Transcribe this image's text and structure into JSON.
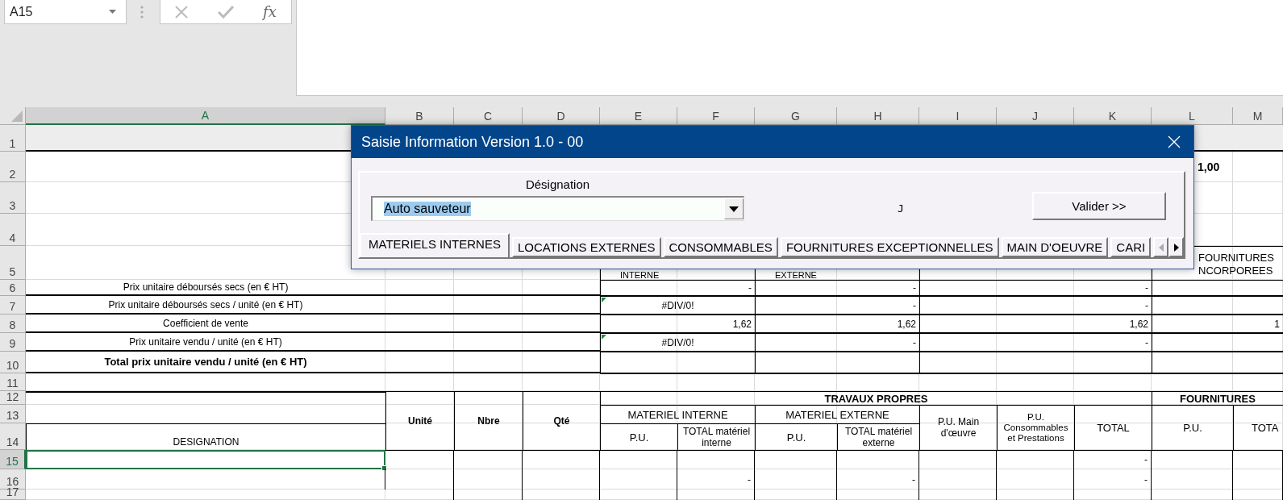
{
  "name_box": {
    "value": "A15"
  },
  "formula_bar": {
    "function_label": "fx"
  },
  "column_headers": [
    {
      "label": "A",
      "selected": true
    },
    {
      "label": "B",
      "selected": false
    },
    {
      "label": "C",
      "selected": false
    },
    {
      "label": "D",
      "selected": false
    },
    {
      "label": "E",
      "selected": false
    },
    {
      "label": "F",
      "selected": false
    },
    {
      "label": "G",
      "selected": false
    },
    {
      "label": "H",
      "selected": false
    },
    {
      "label": "I",
      "selected": false
    },
    {
      "label": "J",
      "selected": false
    },
    {
      "label": "K",
      "selected": false
    },
    {
      "label": "L",
      "selected": false
    },
    {
      "label": "M",
      "selected": false
    }
  ],
  "row_headers": [
    {
      "label": "1",
      "selected": false
    },
    {
      "label": "2",
      "selected": false
    },
    {
      "label": "3",
      "selected": false
    },
    {
      "label": "4",
      "selected": false
    },
    {
      "label": "5",
      "selected": false
    },
    {
      "label": "6",
      "selected": false
    },
    {
      "label": "7",
      "selected": false
    },
    {
      "label": "8",
      "selected": false
    },
    {
      "label": "9",
      "selected": false
    },
    {
      "label": "10",
      "selected": false
    },
    {
      "label": "11",
      "selected": false
    },
    {
      "label": "12",
      "selected": false
    },
    {
      "label": "13",
      "selected": false
    },
    {
      "label": "14",
      "selected": false
    },
    {
      "label": "15",
      "selected": true
    },
    {
      "label": "16",
      "selected": false
    },
    {
      "label": "17",
      "selected": false
    }
  ],
  "sheet": {
    "total_value": "1,00",
    "internal_heading": "INTERNE",
    "external_heading": "EXTERNE",
    "supplies_heading": [
      "FOURNITURES",
      "NCORPOREES"
    ]
  },
  "summary_rows": [
    {
      "label": "Prix unitaire déboursés secs (en € HT)",
      "bold": false,
      "internal": {
        "text": "-",
        "flag": false
      },
      "external": "-",
      "labour": "-"
    },
    {
      "label": "Prix unitaire déboursés secs / unité (en € HT)",
      "bold": false,
      "internal": {
        "text": "#DIV/0!",
        "flag": true
      },
      "external": "-",
      "labour": "-"
    },
    {
      "label": "Coefficient de vente",
      "bold": false,
      "internal": {
        "text": "1,62",
        "flag": false
      },
      "external": "1,62",
      "labour": "1,62",
      "supplies": "1"
    },
    {
      "label": "Prix unitaire vendu / unité (en € HT)",
      "bold": false,
      "internal": {
        "text": "#DIV/0!",
        "flag": true
      },
      "external": "-",
      "labour": "-"
    },
    {
      "label": "Total prix unitaire vendu / unité (en € HT)",
      "bold": true
    }
  ],
  "table_header": {
    "designation": "DESIGNATION",
    "unit": "Unité",
    "count": "Nbre",
    "quantity": "Qté",
    "own_works": "TRAVAUX PROPRES",
    "supplies": "FOURNITURES",
    "internal": "MATERIEL INTERNE",
    "external": "MATERIEL EXTERNE",
    "internal_pu": "P.U.",
    "internal_total": "TOTAL matériel interne",
    "external_pu": "P.U.",
    "external_total": "TOTAL matériel externe",
    "labour_pu": "P.U. Main d'œuvre",
    "consumables_pu": "P.U. Consommables et Prestations",
    "total": "TOTAL",
    "supplies_pu": "P.U.",
    "supplies_total": "TOTA"
  },
  "table_rows": [
    {
      "selected": true,
      "total": "-"
    },
    {
      "selected": false,
      "internal_total": "-",
      "external_total": "-",
      "total": "-"
    }
  ],
  "dialog": {
    "title": "Saisie Information Version 1.0 - 00",
    "designation_label": "Désignation",
    "designation": {
      "value": "Auto sauveteur"
    },
    "marker": "J",
    "validate_button": "Valider >>",
    "tabs": [
      {
        "label": "MATERIELS INTERNES",
        "selected": true
      },
      {
        "label": "LOCATIONS EXTERNES",
        "selected": false
      },
      {
        "label": "CONSOMMABLES",
        "selected": false
      },
      {
        "label": "FOURNITURES EXCEPTIONNELLES",
        "selected": false
      },
      {
        "label": "MAIN D'OEUVRE",
        "selected": false
      },
      {
        "label": "CARI",
        "selected": false
      }
    ]
  }
}
